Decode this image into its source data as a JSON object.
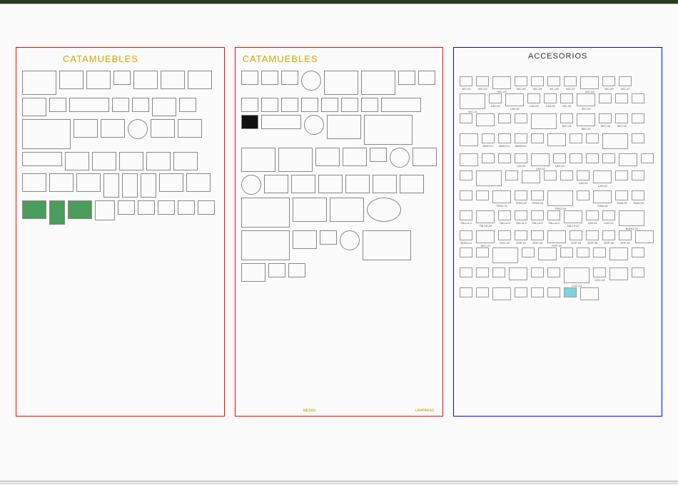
{
  "panels": {
    "p1": {
      "title": "CATAMUEBLES"
    },
    "p2": {
      "title": "CATAMUEBLES",
      "lamp": "LAMPARAS",
      "mesi": "MESAS"
    },
    "p3": {
      "title": "ACCESORIOS"
    }
  },
  "p3_labels": [
    "WC-01",
    "WC-02",
    "WC-03",
    "WC-04",
    "WC-05",
    "WC-06",
    "WC-07",
    "WC-08",
    "WC-09",
    "WC-10",
    "WC-11",
    "LAV-01",
    "LAV-02",
    "LAV-03",
    "LAV-04",
    "WC-01",
    "WC-02",
    "",
    "",
    "",
    "",
    "",
    "",
    "",
    "",
    "MIC-01",
    "MIC-02",
    "MIC-03",
    "MIC-04",
    "",
    "",
    "BANYO-01",
    "BANYO-02",
    "BANYO-03",
    "",
    "",
    "",
    "",
    "",
    "",
    "",
    "",
    "",
    "LAV-01",
    "LAV-02",
    "LAV-03",
    "",
    "",
    "",
    "",
    "",
    "",
    "",
    "",
    "",
    "",
    "",
    "LAV-01",
    "LAV-02",
    "",
    "",
    "",
    "",
    "FRIG-01",
    "FRIG-02",
    "FRIG-03",
    "FRIG-04",
    "",
    "TINA-01",
    "TINA-02",
    "TINA-03",
    "TALLA-01",
    "TALLA-02",
    "TALLA-03",
    "TALLA-04",
    "TALLA-05",
    "TALLA-06",
    "TALLA-07",
    "LAV-01",
    "LAV-02",
    "BURO-01",
    "BURO-02",
    "SEC-01",
    "ESC-02",
    "ESP-01",
    "ESP-02",
    "ESP-03",
    "ESP-04",
    "ESP-05",
    "ESP-06",
    "ESP-07",
    "",
    "",
    "",
    "",
    "",
    "",
    "",
    "",
    "",
    "",
    "",
    "",
    "",
    "",
    "",
    "",
    "",
    "COC-01",
    "COC-02",
    "",
    "",
    "",
    "",
    "",
    "",
    "",
    "",
    "",
    ""
  ]
}
